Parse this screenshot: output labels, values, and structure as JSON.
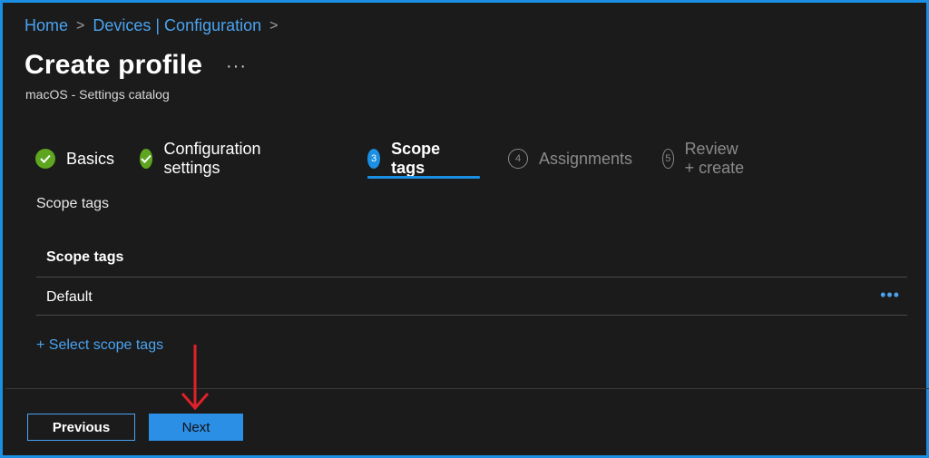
{
  "breadcrumb": {
    "items": [
      "Home",
      "Devices | Configuration"
    ],
    "separator": ">"
  },
  "header": {
    "title": "Create profile",
    "more": "···",
    "subtitle": "macOS - Settings catalog"
  },
  "steps": [
    {
      "label": "Basics",
      "state": "done",
      "number": ""
    },
    {
      "label": "Configuration settings",
      "state": "done",
      "number": ""
    },
    {
      "label": "Scope tags",
      "state": "active",
      "number": "3"
    },
    {
      "label": "Assignments",
      "state": "todo",
      "number": "4"
    },
    {
      "label": "Review + create",
      "state": "todo",
      "number": "5"
    }
  ],
  "section": {
    "label": "Scope tags"
  },
  "table": {
    "header": "Scope tags",
    "rows": [
      {
        "value": "Default",
        "more": "•••"
      }
    ]
  },
  "select_link": "+ Select scope tags",
  "footer": {
    "previous": "Previous",
    "next": "Next"
  },
  "colors": {
    "accent": "#1a8fe3",
    "link": "#4aa3f0",
    "success": "#5ea61f",
    "annotation_arrow": "#e0202a",
    "background": "#1b1b1b"
  }
}
